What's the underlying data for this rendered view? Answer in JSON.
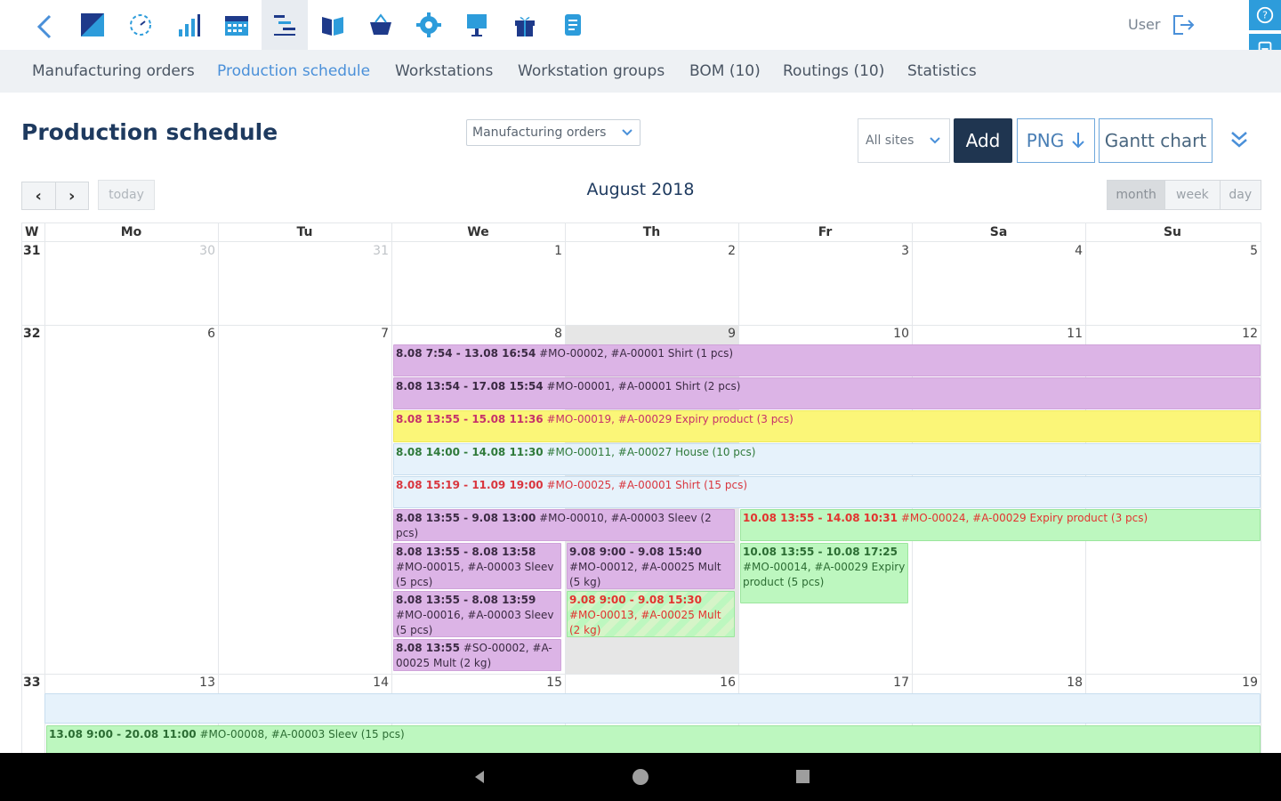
{
  "topbar": {
    "icons": [
      "back-chevron-icon",
      "dashboard-icon",
      "timer-icon",
      "bar-chart-icon",
      "calendar-icon",
      "production-schedule-icon",
      "book-icon",
      "basket-icon",
      "gear-icon",
      "presentation-icon",
      "gift-icon",
      "document-icon"
    ],
    "user_label": "User",
    "accent_color": "#2d9cdb"
  },
  "subnav": {
    "items": [
      "Manufacturing orders",
      "Production schedule",
      "Workstations",
      "Workstation groups",
      "BOM (10)",
      "Routings (10)",
      "Statistics"
    ],
    "active_index": 1
  },
  "page": {
    "title": "Production schedule",
    "filter_select": "Manufacturing orders",
    "sites_select": "All sites",
    "add_label": "Add",
    "png_label": "PNG",
    "gantt_label": "Gantt chart",
    "today_label": "today",
    "month_title": "August 2018",
    "views": [
      "month",
      "week",
      "day"
    ],
    "active_view": "month"
  },
  "calendar": {
    "week_header": "W",
    "day_headers": [
      "Mo",
      "Tu",
      "We",
      "Th",
      "Fr",
      "Sa",
      "Su"
    ],
    "weeks": [
      {
        "num": "31",
        "days": [
          "30",
          "31",
          "1",
          "2",
          "3",
          "4",
          "5"
        ],
        "other": [
          true,
          true,
          false,
          false,
          false,
          false,
          false
        ]
      },
      {
        "num": "32",
        "days": [
          "6",
          "7",
          "8",
          "9",
          "10",
          "11",
          "12"
        ],
        "other": [
          false,
          false,
          false,
          false,
          false,
          false,
          false
        ]
      },
      {
        "num": "33",
        "days": [
          "13",
          "14",
          "15",
          "16",
          "17",
          "18",
          "19"
        ],
        "other": [
          false,
          false,
          false,
          false,
          false,
          false,
          false
        ]
      }
    ],
    "events": {
      "e1": {
        "time": "8.08 7:54 - 13.08 16:54",
        "text": " #MO-00002, #A-00001 Shirt (1 pcs)"
      },
      "e2": {
        "time": "8.08 13:54 - 17.08 15:54",
        "text": " #MO-00001, #A-00001 Shirt (2 pcs)"
      },
      "e3": {
        "time": "8.08 13:55 - 15.08 11:36",
        "text": " #MO-00019, #A-00029 Expiry product (3 pcs)"
      },
      "e4": {
        "time": "8.08 14:00 - 14.08 11:30",
        "text": " #MO-00011, #A-00027 House (10 pcs)"
      },
      "e5": {
        "time": "8.08 15:19 - 11.09 19:00",
        "text": " #MO-00025, #A-00001 Shirt (15 pcs)"
      },
      "e6": {
        "time": "8.08 13:55 - 9.08 13:00",
        "text": " #MO-00010, #A-00003 Sleev (2 pcs)"
      },
      "e7": {
        "time": "10.08 13:55 - 14.08 10:31",
        "text": " #MO-00024, #A-00029 Expiry product (3 pcs)"
      },
      "e8": {
        "time": "8.08 13:55 - 8.08 13:58",
        "text": " #MO-00015, #A-00003 Sleev (5 pcs)"
      },
      "e9": {
        "time": "9.08 9:00 - 9.08 15:40",
        "text": " #MO-00012, #A-00025 Mult (5 kg)"
      },
      "e10": {
        "time": "10.08 13:55 - 10.08 17:25",
        "text": " #MO-00014, #A-00029 Expiry product (5 pcs)"
      },
      "e11": {
        "time": "8.08 13:55 - 8.08 13:59",
        "text": " #MO-00016, #A-00003 Sleev (5 pcs)"
      },
      "e12": {
        "time": "9.08 9:00 - 9.08 15:30",
        "text": " #MO-00013, #A-00025 Mult (2 kg)"
      },
      "e13": {
        "time": "8.08 13:55",
        "text": " #SO-00002, #A-00025 Mult (2 kg)"
      },
      "e14": {
        "time": "13.08 9:00 - 20.08 11:00",
        "text": " #MO-00008, #A-00003 Sleev (15 pcs)"
      }
    }
  }
}
